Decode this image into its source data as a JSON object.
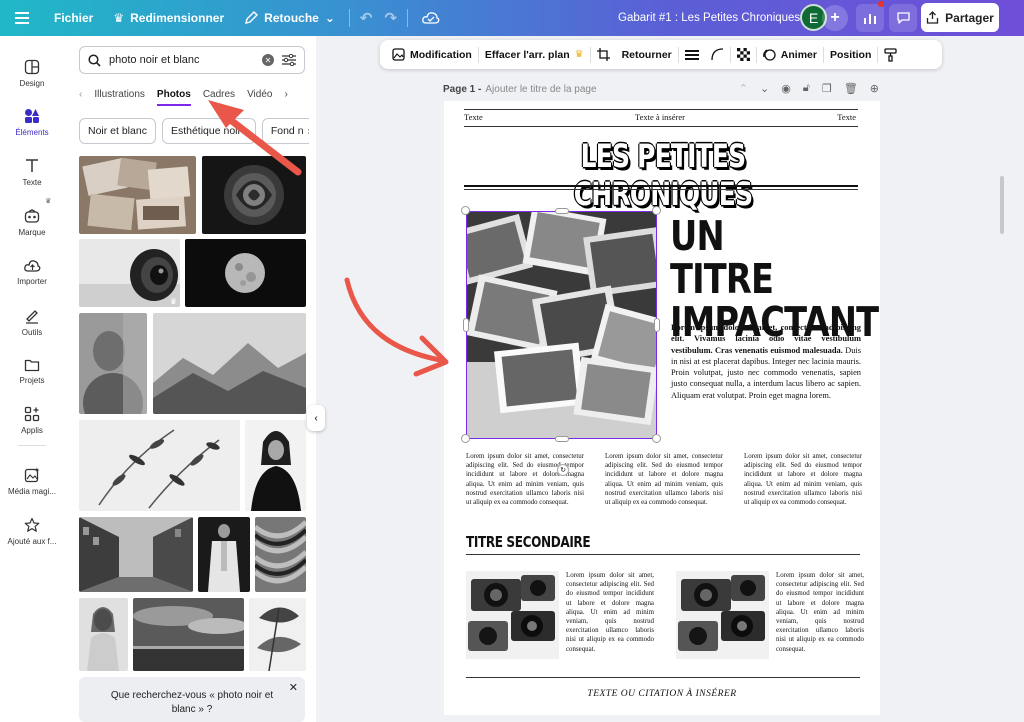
{
  "topbar": {
    "file": "Fichier",
    "resize": "Redimensionner",
    "edit": "Retouche",
    "title": "Gabarit #1 : Les Petites Chroniques",
    "avatar": "E",
    "share": "Partager"
  },
  "rail": [
    {
      "label": "Design",
      "icon": "layout-icon"
    },
    {
      "label": "Éléments",
      "icon": "shapes-icon"
    },
    {
      "label": "Texte",
      "icon": "text-icon"
    },
    {
      "label": "Marque",
      "icon": "brand-icon"
    },
    {
      "label": "Importer",
      "icon": "upload-cloud-icon"
    },
    {
      "label": "Outils",
      "icon": "pen-tool-icon"
    },
    {
      "label": "Projets",
      "icon": "folder-icon"
    },
    {
      "label": "Applis",
      "icon": "apps-grid-icon"
    },
    {
      "label": "Média magi...",
      "icon": "magic-media-icon"
    },
    {
      "label": "Ajouté aux f...",
      "icon": "star-icon"
    }
  ],
  "panel": {
    "search_value": "photo noir et blanc",
    "tabs": [
      "Illustrations",
      "Photos",
      "Cadres",
      "Vidéo"
    ],
    "chips": [
      "Noir et blanc",
      "Esthétique noire",
      "Fond n"
    ],
    "suggestion": "Que recherchez-vous « photo noir et blanc » ?"
  },
  "toolbar": {
    "edit": "Modification",
    "bg_remove": "Effacer l'arr. plan",
    "flip": "Retourner",
    "animate": "Animer",
    "position": "Position"
  },
  "page": {
    "label": "Page 1 -",
    "title_placeholder": "Ajouter le titre de la page"
  },
  "doc": {
    "top_left": "Texte",
    "top_center": "Texte à insérer",
    "top_right": "Texte",
    "masthead": "LES PETITES CHRONIQUES",
    "headline_1": "UN TITRE",
    "headline_2": "IMPACTANT",
    "lede_bold": "Lorem ipsum dolor sit amet, consectetur adipiscing elit. Vivamus lacinia odio vitae vestibulum vestibulum. Cras venenatis euismod malesuada.",
    "lede": "Duis in nisi at est placerat dapibus. Integer nec lacinia mauris. Proin volutpat, justo nec commodo venenatis, sapien justo consequat nulla, a interdum lacus libero ac sapien. Aliquam erat volutpat. Proin eget magna lorem.",
    "column_1": "Lorem ipsum dolor sit amet, consectetur adipiscing elit. Sed do eiusmod tempor incididunt ut labore et dolore magna aliqua. Ut enim ad minim veniam, quis nostrud exercitation ullamco laboris nisi ut aliquip ex ea commodo consequat.",
    "column_2": "Lorem ipsum dolor sit amet, consectetur adipiscing elit. Sed do eiusmod tempor incididunt ut labore et dolore magna aliqua. Ut enim ad minim veniam, quis nostrud exercitation ullamco laboris nisi ut aliquip ex ea commodo consequat.",
    "column_3": "Lorem ipsum dolor sit amet, consectetur adipiscing elit. Sed do eiusmod tempor incididunt ut labore et dolore magna aliqua. Ut enim ad minim veniam, quis nostrud exercitation ullamco laboris nisi ut aliquip ex ea commodo consequat.",
    "subtitle": "TITRE SECONDAIRE",
    "cam_text_1": "Lorem ipsum dolor sit amet, consectetur adipiscing elit. Sed do eiusmod tempor incididunt ut labore et dolore magna aliqua. Ut enim ad minim veniam, quis nostrud exercitation ullamco laboris nisi ut aliquip ex ea commodo consequat.",
    "cam_text_2": "Lorem ipsum dolor sit amet, consectetur adipiscing elit. Sed do eiusmod tempor incididunt ut labore et dolore magna aliqua. Ut enim ad minim veniam, quis nostrud exercitation ullamco laboris nisi ut aliquip ex ea commodo consequat.",
    "quote": "TEXTE OU CITATION À INSÉRER"
  },
  "colors": {
    "accent": "#7d2ae8",
    "arrow": "#e8574a",
    "avatar": "#0f6b35"
  }
}
